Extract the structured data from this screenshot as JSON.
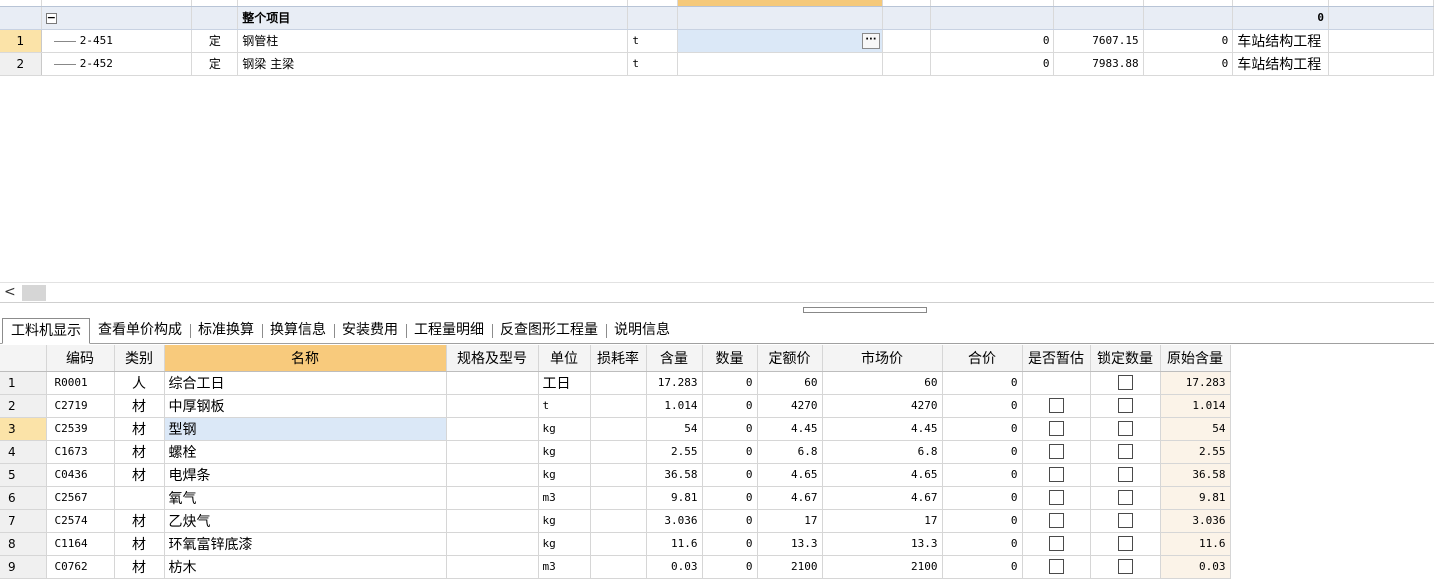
{
  "top_grid": {
    "group_row": {
      "label": "整个项目",
      "total": "0"
    },
    "rows": [
      {
        "num": "1",
        "code": "2-451",
        "type": "定",
        "name": "钢管柱",
        "unit": "t",
        "qty": "0",
        "price": "7607.15",
        "total": "0",
        "category": "车站结构工程"
      },
      {
        "num": "2",
        "code": "2-452",
        "type": "定",
        "name": "钢梁 主梁",
        "unit": "t",
        "qty": "0",
        "price": "7983.88",
        "total": "0",
        "category": "车站结构工程"
      }
    ],
    "ellipsis": "···",
    "collapse_symbol": "−"
  },
  "scrollbar": {
    "left_arrow": "<"
  },
  "tabs": [
    {
      "label": "工料机显示",
      "active": true
    },
    {
      "label": "查看单价构成"
    },
    {
      "label": "标准换算"
    },
    {
      "label": "换算信息"
    },
    {
      "label": "安装费用"
    },
    {
      "label": "工程量明细"
    },
    {
      "label": "反查图形工程量"
    },
    {
      "label": "说明信息"
    }
  ],
  "bottom_grid": {
    "headers": [
      "",
      "编码",
      "类别",
      "名称",
      "规格及型号",
      "单位",
      "损耗率",
      "含量",
      "数量",
      "定额价",
      "市场价",
      "合价",
      "是否暂估",
      "锁定数量",
      "原始含量"
    ],
    "rows": [
      {
        "num": "1",
        "code": "R0001",
        "type": "人",
        "name": "综合工日",
        "spec": "",
        "unit": "工日",
        "loss": "",
        "content": "17.283",
        "qty": "0",
        "quota_price": "60",
        "market_price": "60",
        "total": "0",
        "estimate": false,
        "lock": true,
        "orig": "17.283"
      },
      {
        "num": "2",
        "code": "C2719",
        "type": "材",
        "name": "中厚钢板",
        "spec": "",
        "unit": "t",
        "loss": "",
        "content": "1.014",
        "qty": "0",
        "quota_price": "4270",
        "market_price": "4270",
        "total": "0",
        "estimate": true,
        "lock": true,
        "orig": "1.014"
      },
      {
        "num": "3",
        "code": "C2539",
        "type": "材",
        "name": "型钢",
        "spec": "",
        "unit": "kg",
        "loss": "",
        "content": "54",
        "qty": "0",
        "quota_price": "4.45",
        "market_price": "4.45",
        "total": "0",
        "estimate": true,
        "lock": true,
        "orig": "54"
      },
      {
        "num": "4",
        "code": "C1673",
        "type": "材",
        "name": "螺栓",
        "spec": "",
        "unit": "kg",
        "loss": "",
        "content": "2.55",
        "qty": "0",
        "quota_price": "6.8",
        "market_price": "6.8",
        "total": "0",
        "estimate": true,
        "lock": true,
        "orig": "2.55"
      },
      {
        "num": "5",
        "code": "C0436",
        "type": "材",
        "name": "电焊条",
        "spec": "",
        "unit": "kg",
        "loss": "",
        "content": "36.58",
        "qty": "0",
        "quota_price": "4.65",
        "market_price": "4.65",
        "total": "0",
        "estimate": true,
        "lock": true,
        "orig": "36.58"
      },
      {
        "num": "6",
        "code": "C2567",
        "type": "",
        "name": "氧气",
        "spec": "",
        "unit": "m3",
        "loss": "",
        "content": "9.81",
        "qty": "0",
        "quota_price": "4.67",
        "market_price": "4.67",
        "total": "0",
        "estimate": true,
        "lock": true,
        "orig": "9.81"
      },
      {
        "num": "7",
        "code": "C2574",
        "type": "材",
        "name": "乙炔气",
        "spec": "",
        "unit": "kg",
        "loss": "",
        "content": "3.036",
        "qty": "0",
        "quota_price": "17",
        "market_price": "17",
        "total": "0",
        "estimate": true,
        "lock": true,
        "orig": "3.036"
      },
      {
        "num": "8",
        "code": "C1164",
        "type": "材",
        "name": "环氧富锌底漆",
        "spec": "",
        "unit": "kg",
        "loss": "",
        "content": "11.6",
        "qty": "0",
        "quota_price": "13.3",
        "market_price": "13.3",
        "total": "0",
        "estimate": true,
        "lock": true,
        "orig": "11.6"
      },
      {
        "num": "9",
        "code": "C0762",
        "type": "材",
        "name": "枋木",
        "spec": "",
        "unit": "m3",
        "loss": "",
        "content": "0.03",
        "qty": "0",
        "quota_price": "2100",
        "market_price": "2100",
        "total": "0",
        "estimate": true,
        "lock": true,
        "orig": "0.03"
      }
    ]
  }
}
